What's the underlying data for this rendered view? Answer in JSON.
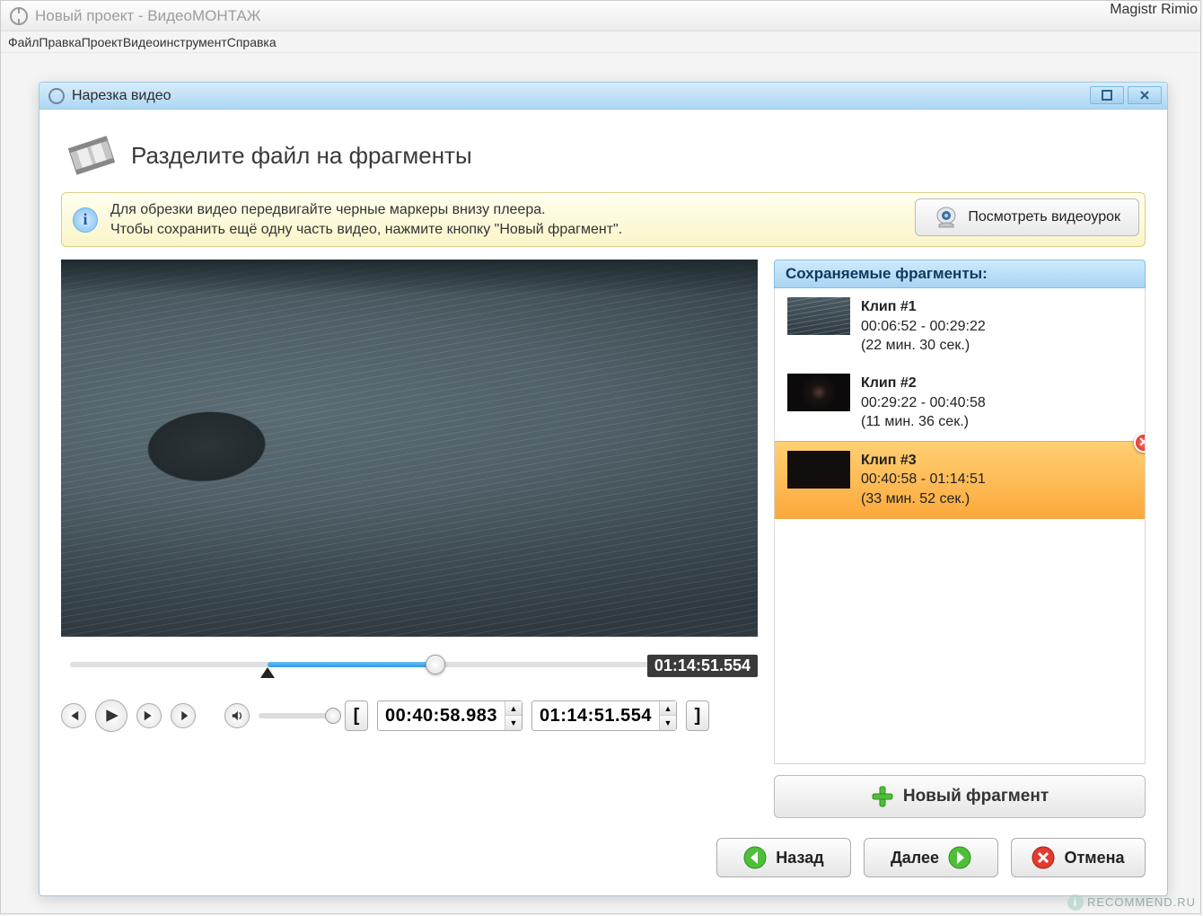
{
  "watermark_top": "Magistr Rimio",
  "watermark_bottom": "RECOMMEND.RU",
  "app": {
    "title": "Новый проект - ВидеоМОНТАЖ"
  },
  "menubar": [
    "Файл",
    "Правка",
    "Проект",
    "Видеоинструмент",
    "Справка"
  ],
  "dialog": {
    "title": "Нарезка видео",
    "heading": "Разделите файл на фрагменты",
    "info_line1": "Для обрезки видео передвигайте черные маркеры внизу плеера.",
    "info_line2": "Чтобы сохранить ещё одну часть видео, нажмите кнопку \"Новый фрагмент\".",
    "tutorial_label": "Посмотреть видеоурок"
  },
  "timeline": {
    "total_label": "01:14:51.554",
    "start_value": "00:40:58.983",
    "end_value": "01:14:51.554",
    "sel_left_pct": 34,
    "sel_right_pct": 63
  },
  "frags": {
    "header": "Сохраняемые фрагменты:",
    "items": [
      {
        "title": "Клип #1",
        "range": "00:06:52 - 00:29:22",
        "duration": "(22 мин. 30 сек.)",
        "thumb": "water",
        "selected": false
      },
      {
        "title": "Клип #2",
        "range": "00:29:22 - 00:40:58",
        "duration": "(11 мин. 36 сек.)",
        "thumb": "face",
        "selected": false
      },
      {
        "title": "Клип #3",
        "range": "00:40:58 - 01:14:51",
        "duration": "(33 мин. 52 сек.)",
        "thumb": "dark",
        "selected": true
      }
    ],
    "new_label": "Новый фрагмент"
  },
  "wizard": {
    "back": "Назад",
    "next": "Далее",
    "cancel": "Отмена"
  }
}
